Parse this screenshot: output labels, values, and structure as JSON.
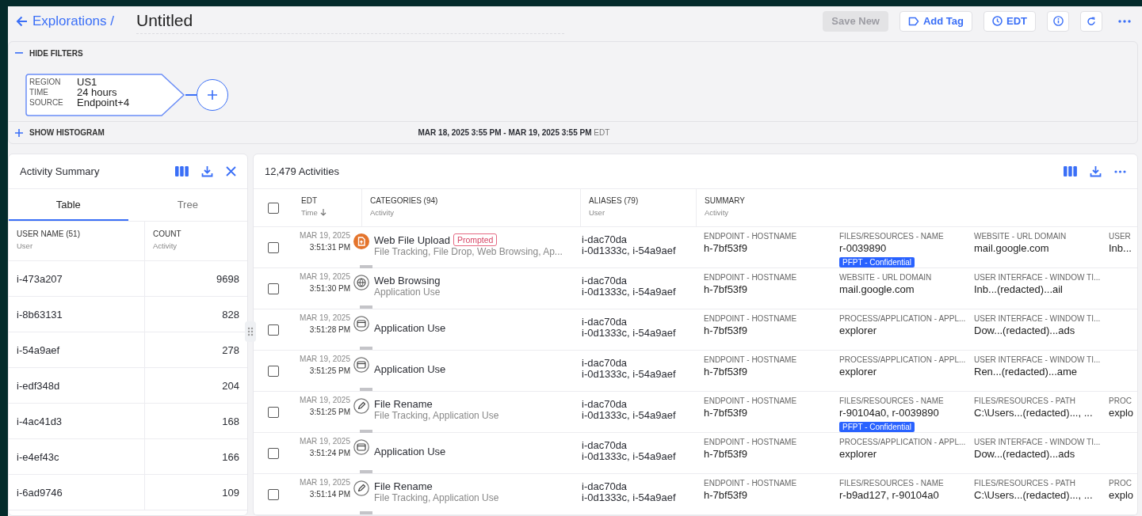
{
  "header": {
    "back_link": "Explorations /",
    "title": "Untitled",
    "buttons": [
      {
        "kind": "text",
        "label": "Save New",
        "disabled": true
      },
      {
        "kind": "tag",
        "label": "Add Tag"
      },
      {
        "kind": "clock",
        "label": "EDT"
      },
      {
        "kind": "info"
      },
      {
        "kind": "refresh"
      },
      {
        "kind": "more"
      }
    ]
  },
  "filters": {
    "hide_label": "HIDE FILTERS",
    "chip": [
      {
        "key": "REGION",
        "value": "US1"
      },
      {
        "key": "TIME",
        "value": "24 hours"
      },
      {
        "key": "SOURCE",
        "value": "Endpoint+4"
      }
    ],
    "histogram_label": "SHOW HISTOGRAM",
    "range": "MAR 18, 2025 3:55 PM - MAR 19, 2025 3:55 PM",
    "timezone": "EDT"
  },
  "summary_panel": {
    "title": "Activity Summary",
    "tabs": [
      {
        "label": "Table",
        "selected": true
      },
      {
        "label": "Tree",
        "selected": false
      }
    ],
    "columns": [
      {
        "label": "USER NAME (51)",
        "sub": "User"
      },
      {
        "label": "COUNT",
        "sub": "Activity"
      }
    ],
    "rows": [
      {
        "user": "i-473a207",
        "count": "9698"
      },
      {
        "user": "i-8b63131",
        "count": "828"
      },
      {
        "user": "i-54a9aef",
        "count": "278"
      },
      {
        "user": "i-edf348d",
        "count": "204"
      },
      {
        "user": "i-4ac41d3",
        "count": "168"
      },
      {
        "user": "i-e4ef43c",
        "count": "166"
      },
      {
        "user": "i-6ad9746",
        "count": "109"
      }
    ]
  },
  "activities": {
    "title": "12,479 Activities",
    "select_all_checked": false,
    "columns": [
      {
        "label": "EDT",
        "sub": "Time"
      },
      {
        "label": "CATEGORIES (94)",
        "sub": "Activity"
      },
      {
        "label": "ALIASES (79)",
        "sub": "User"
      },
      {
        "label": "SUMMARY",
        "sub": "Activity"
      }
    ],
    "rows": [
      {
        "checked": false,
        "date": "MAR 19, 2025",
        "time": "3:51:31 PM",
        "kind": "upload",
        "title": "Web File Upload",
        "badge": "Prompted",
        "subtitle": "File Tracking, File Drop, Web Browsing, Ap...",
        "aliases": [
          "i-dac70da",
          "i-0d1333c, i-54a9aef"
        ],
        "summary": [
          {
            "label": "ENDPOINT - HOSTNAME",
            "value": "h-7bf53f9"
          },
          {
            "label": "FILES/RESOURCES - NAME",
            "value": "r-0039890",
            "tag": "PFPT - Confidential"
          },
          {
            "label": "WEBSITE - URL DOMAIN",
            "value": "mail.google.com"
          },
          {
            "label": "USER",
            "value": "Inb..."
          }
        ]
      },
      {
        "checked": false,
        "date": "MAR 19, 2025",
        "time": "3:51:30 PM",
        "kind": "browse",
        "title": "Web Browsing",
        "subtitle": "Application Use",
        "aliases": [
          "i-dac70da",
          "i-0d1333c, i-54a9aef"
        ],
        "summary": [
          {
            "label": "ENDPOINT - HOSTNAME",
            "value": "h-7bf53f9"
          },
          {
            "label": "WEBSITE - URL DOMAIN",
            "value": "mail.google.com"
          },
          {
            "label": "USER INTERFACE - WINDOW TI...",
            "value": "Inb...(redacted)...ail"
          }
        ]
      },
      {
        "checked": false,
        "date": "MAR 19, 2025",
        "time": "3:51:28 PM",
        "kind": "app",
        "title": "Application Use",
        "aliases": [
          "i-dac70da",
          "i-0d1333c, i-54a9aef"
        ],
        "summary": [
          {
            "label": "ENDPOINT - HOSTNAME",
            "value": "h-7bf53f9"
          },
          {
            "label": "PROCESS/APPLICATION - APPL...",
            "value": "explorer"
          },
          {
            "label": "USER INTERFACE - WINDOW TI...",
            "value": "Dow...(redacted)...ads"
          }
        ]
      },
      {
        "checked": false,
        "date": "MAR 19, 2025",
        "time": "3:51:25 PM",
        "kind": "app",
        "title": "Application Use",
        "aliases": [
          "i-dac70da",
          "i-0d1333c, i-54a9aef"
        ],
        "summary": [
          {
            "label": "ENDPOINT - HOSTNAME",
            "value": "h-7bf53f9"
          },
          {
            "label": "PROCESS/APPLICATION - APPL...",
            "value": "explorer"
          },
          {
            "label": "USER INTERFACE - WINDOW TI...",
            "value": "Ren...(redacted)...ame"
          }
        ]
      },
      {
        "checked": false,
        "date": "MAR 19, 2025",
        "time": "3:51:25 PM",
        "kind": "rename",
        "title": "File Rename",
        "subtitle": "File Tracking, Application Use",
        "aliases": [
          "i-dac70da",
          "i-0d1333c, i-54a9aef"
        ],
        "summary": [
          {
            "label": "ENDPOINT - HOSTNAME",
            "value": "h-7bf53f9"
          },
          {
            "label": "FILES/RESOURCES - NAME",
            "value": "r-90104a0, r-0039890",
            "tag": "PFPT - Confidential"
          },
          {
            "label": "FILES/RESOURCES - PATH",
            "value": "C:\\Users...(redacted)..., ..."
          },
          {
            "label": "PROC",
            "value": "explo"
          }
        ]
      },
      {
        "checked": false,
        "date": "MAR 19, 2025",
        "time": "3:51:24 PM",
        "kind": "app",
        "title": "Application Use",
        "aliases": [
          "i-dac70da",
          "i-0d1333c, i-54a9aef"
        ],
        "summary": [
          {
            "label": "ENDPOINT - HOSTNAME",
            "value": "h-7bf53f9"
          },
          {
            "label": "PROCESS/APPLICATION - APPL...",
            "value": "explorer"
          },
          {
            "label": "USER INTERFACE - WINDOW TI...",
            "value": "Dow...(redacted)...ads"
          }
        ]
      },
      {
        "checked": false,
        "date": "MAR 19, 2025",
        "time": "3:51:14 PM",
        "kind": "rename",
        "title": "File Rename",
        "subtitle": "File Tracking, Application Use",
        "aliases": [
          "i-dac70da",
          "i-0d1333c, i-54a9aef"
        ],
        "summary": [
          {
            "label": "ENDPOINT - HOSTNAME",
            "value": "h-7bf53f9"
          },
          {
            "label": "FILES/RESOURCES - NAME",
            "value": "r-b9ad127, r-90104a0"
          },
          {
            "label": "FILES/RESOURCES - PATH",
            "value": "C:\\Users...(redacted)..., ..."
          },
          {
            "label": "PROC",
            "value": "explo"
          }
        ]
      }
    ]
  }
}
